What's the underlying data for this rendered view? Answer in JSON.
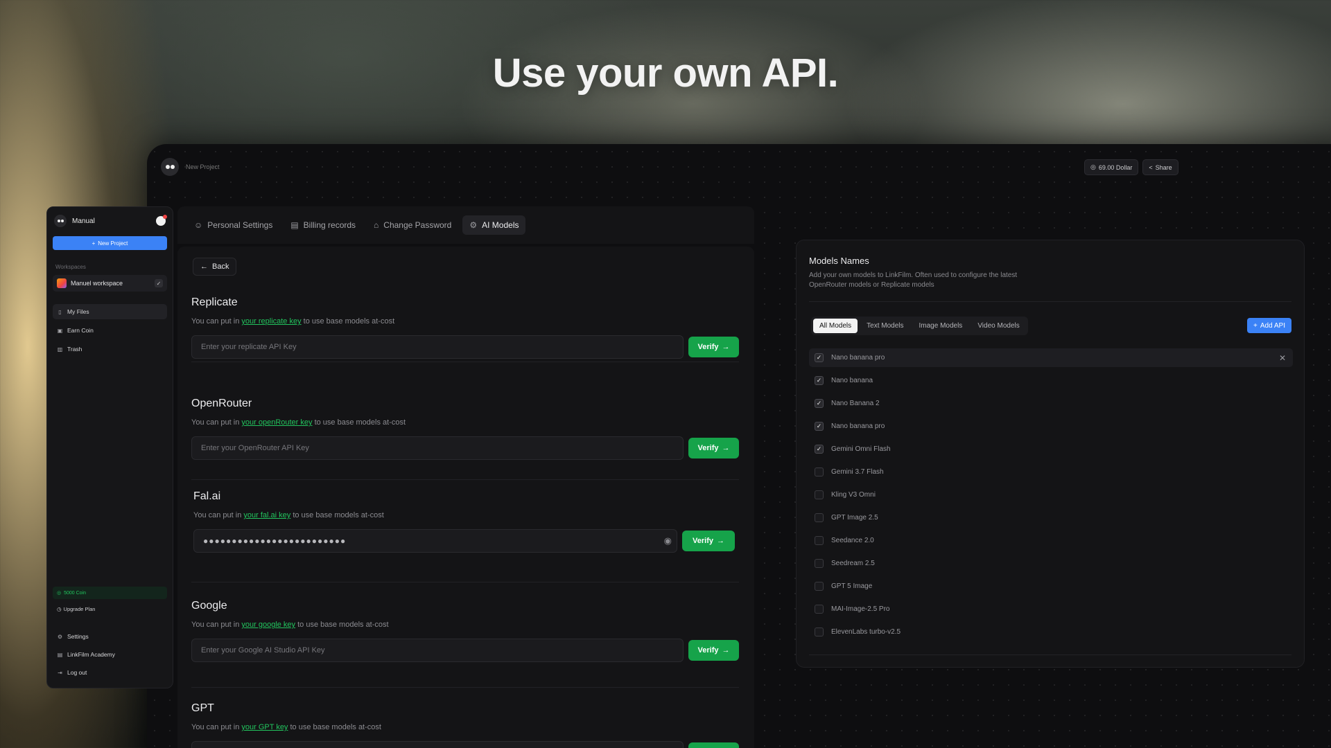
{
  "headline": "Use your own API.",
  "topbar": {
    "project_title": "New Project",
    "balance": "69.00 Dollar",
    "share": "Share"
  },
  "sidebar": {
    "user_name": "Manual",
    "new_project": "New Project",
    "workspaces_label": "Workspaces",
    "workspace_name": "Manuel workspace",
    "nav": [
      {
        "label": "My Files",
        "icon": "file-icon"
      },
      {
        "label": "Earn Coin",
        "icon": "gift-icon"
      },
      {
        "label": "Trash",
        "icon": "trash-icon"
      }
    ],
    "coins": "5000 Coin",
    "upgrade": "Upgrade Plan",
    "bottom_nav": [
      {
        "label": "Settings",
        "icon": "gear-icon"
      },
      {
        "label": "LinkFilm Academy",
        "icon": "book-icon"
      },
      {
        "label": "Log out",
        "icon": "logout-icon"
      }
    ]
  },
  "tabs": [
    {
      "label": "Personal Settings",
      "icon": "user-icon"
    },
    {
      "label": "Billing records",
      "icon": "receipt-icon"
    },
    {
      "label": "Change Password",
      "icon": "lock-icon"
    },
    {
      "label": "AI Models",
      "icon": "gear-icon",
      "active": true
    }
  ],
  "back_label": "Back",
  "verify_label": "Verify",
  "api_sections": [
    {
      "title": "Replicate",
      "desc_prefix": "You can put in ",
      "link": "your replicate key",
      "desc_suffix": " to use base models at-cost",
      "placeholder": "Enter your replicate API Key",
      "value": ""
    },
    {
      "title": "OpenRouter",
      "desc_prefix": "You can put in ",
      "link": "your openRouter key",
      "desc_suffix": " to use base models at-cost",
      "placeholder": "Enter your OpenRouter API Key",
      "value": ""
    },
    {
      "title": "Fal.ai",
      "desc_prefix": "You can put in ",
      "link": "your fal.ai key",
      "desc_suffix": " to use base models at-cost",
      "placeholder": "",
      "value": "●●●●●●●●●●●●●●●●●●●●●●●●●"
    },
    {
      "title": "Google",
      "desc_prefix": "You can put in ",
      "link": "your google key",
      "desc_suffix": " to use base models at-cost",
      "placeholder": "Enter your Google AI Studio API Key",
      "value": ""
    },
    {
      "title": "GPT",
      "desc_prefix": "You can put in ",
      "link": "your GPT key",
      "desc_suffix": " to use base models at-cost",
      "placeholder": "",
      "value": ""
    }
  ],
  "models_panel": {
    "title": "Models Names",
    "desc": "Add your own models to LinkFilm. Often used to configure the latest OpenRouter models or Replicate models",
    "filters": [
      "All Models",
      "Text Models",
      "Image Models",
      "Video Models"
    ],
    "active_filter": "All Models",
    "add_api": "Add API",
    "models": [
      {
        "name": "Nano banana pro",
        "checked": true
      },
      {
        "name": "Nano banana",
        "checked": true
      },
      {
        "name": "Nano Banana 2",
        "checked": true
      },
      {
        "name": "Nano banana pro",
        "checked": true
      },
      {
        "name": "Gemini Omni Flash",
        "checked": true
      },
      {
        "name": "Gemini 3.7 Flash",
        "checked": false
      },
      {
        "name": "Kling V3 Omni",
        "checked": false
      },
      {
        "name": "GPT Image 2.5",
        "checked": false
      },
      {
        "name": "Seedance 2.0",
        "checked": false
      },
      {
        "name": "Seedream 2.5",
        "checked": false
      },
      {
        "name": "GPT 5 Image",
        "checked": false
      },
      {
        "name": "MAI-Image-2.5 Pro",
        "checked": false
      },
      {
        "name": "ElevenLabs turbo-v2.5",
        "checked": false
      }
    ]
  },
  "colors": {
    "accent_green": "#16a34a",
    "accent_blue": "#3b82f6",
    "panel_bg": "#141416"
  }
}
